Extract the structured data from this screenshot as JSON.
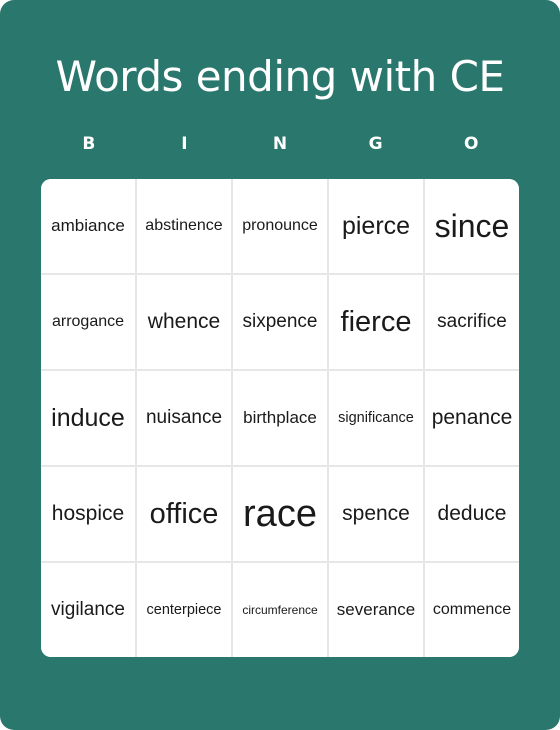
{
  "title": "Words ending with CE",
  "header_letters": [
    "B",
    "I",
    "N",
    "G",
    "O"
  ],
  "rows": [
    [
      "ambiance",
      "abstinence",
      "pronounce",
      "pierce",
      "since"
    ],
    [
      "arrogance",
      "whence",
      "sixpence",
      "fierce",
      "sacrifice"
    ],
    [
      "induce",
      "nuisance",
      "birthplace",
      "significance",
      "penance"
    ],
    [
      "hospice",
      "office",
      "race",
      "spence",
      "deduce"
    ],
    [
      "vigilance",
      "centerpiece",
      "circumference",
      "severance",
      "commence"
    ]
  ],
  "colors": {
    "background": "#2a776e",
    "cell": "#ffffff",
    "grid_line": "#e6e8e8",
    "text": "#1a1a1a"
  }
}
